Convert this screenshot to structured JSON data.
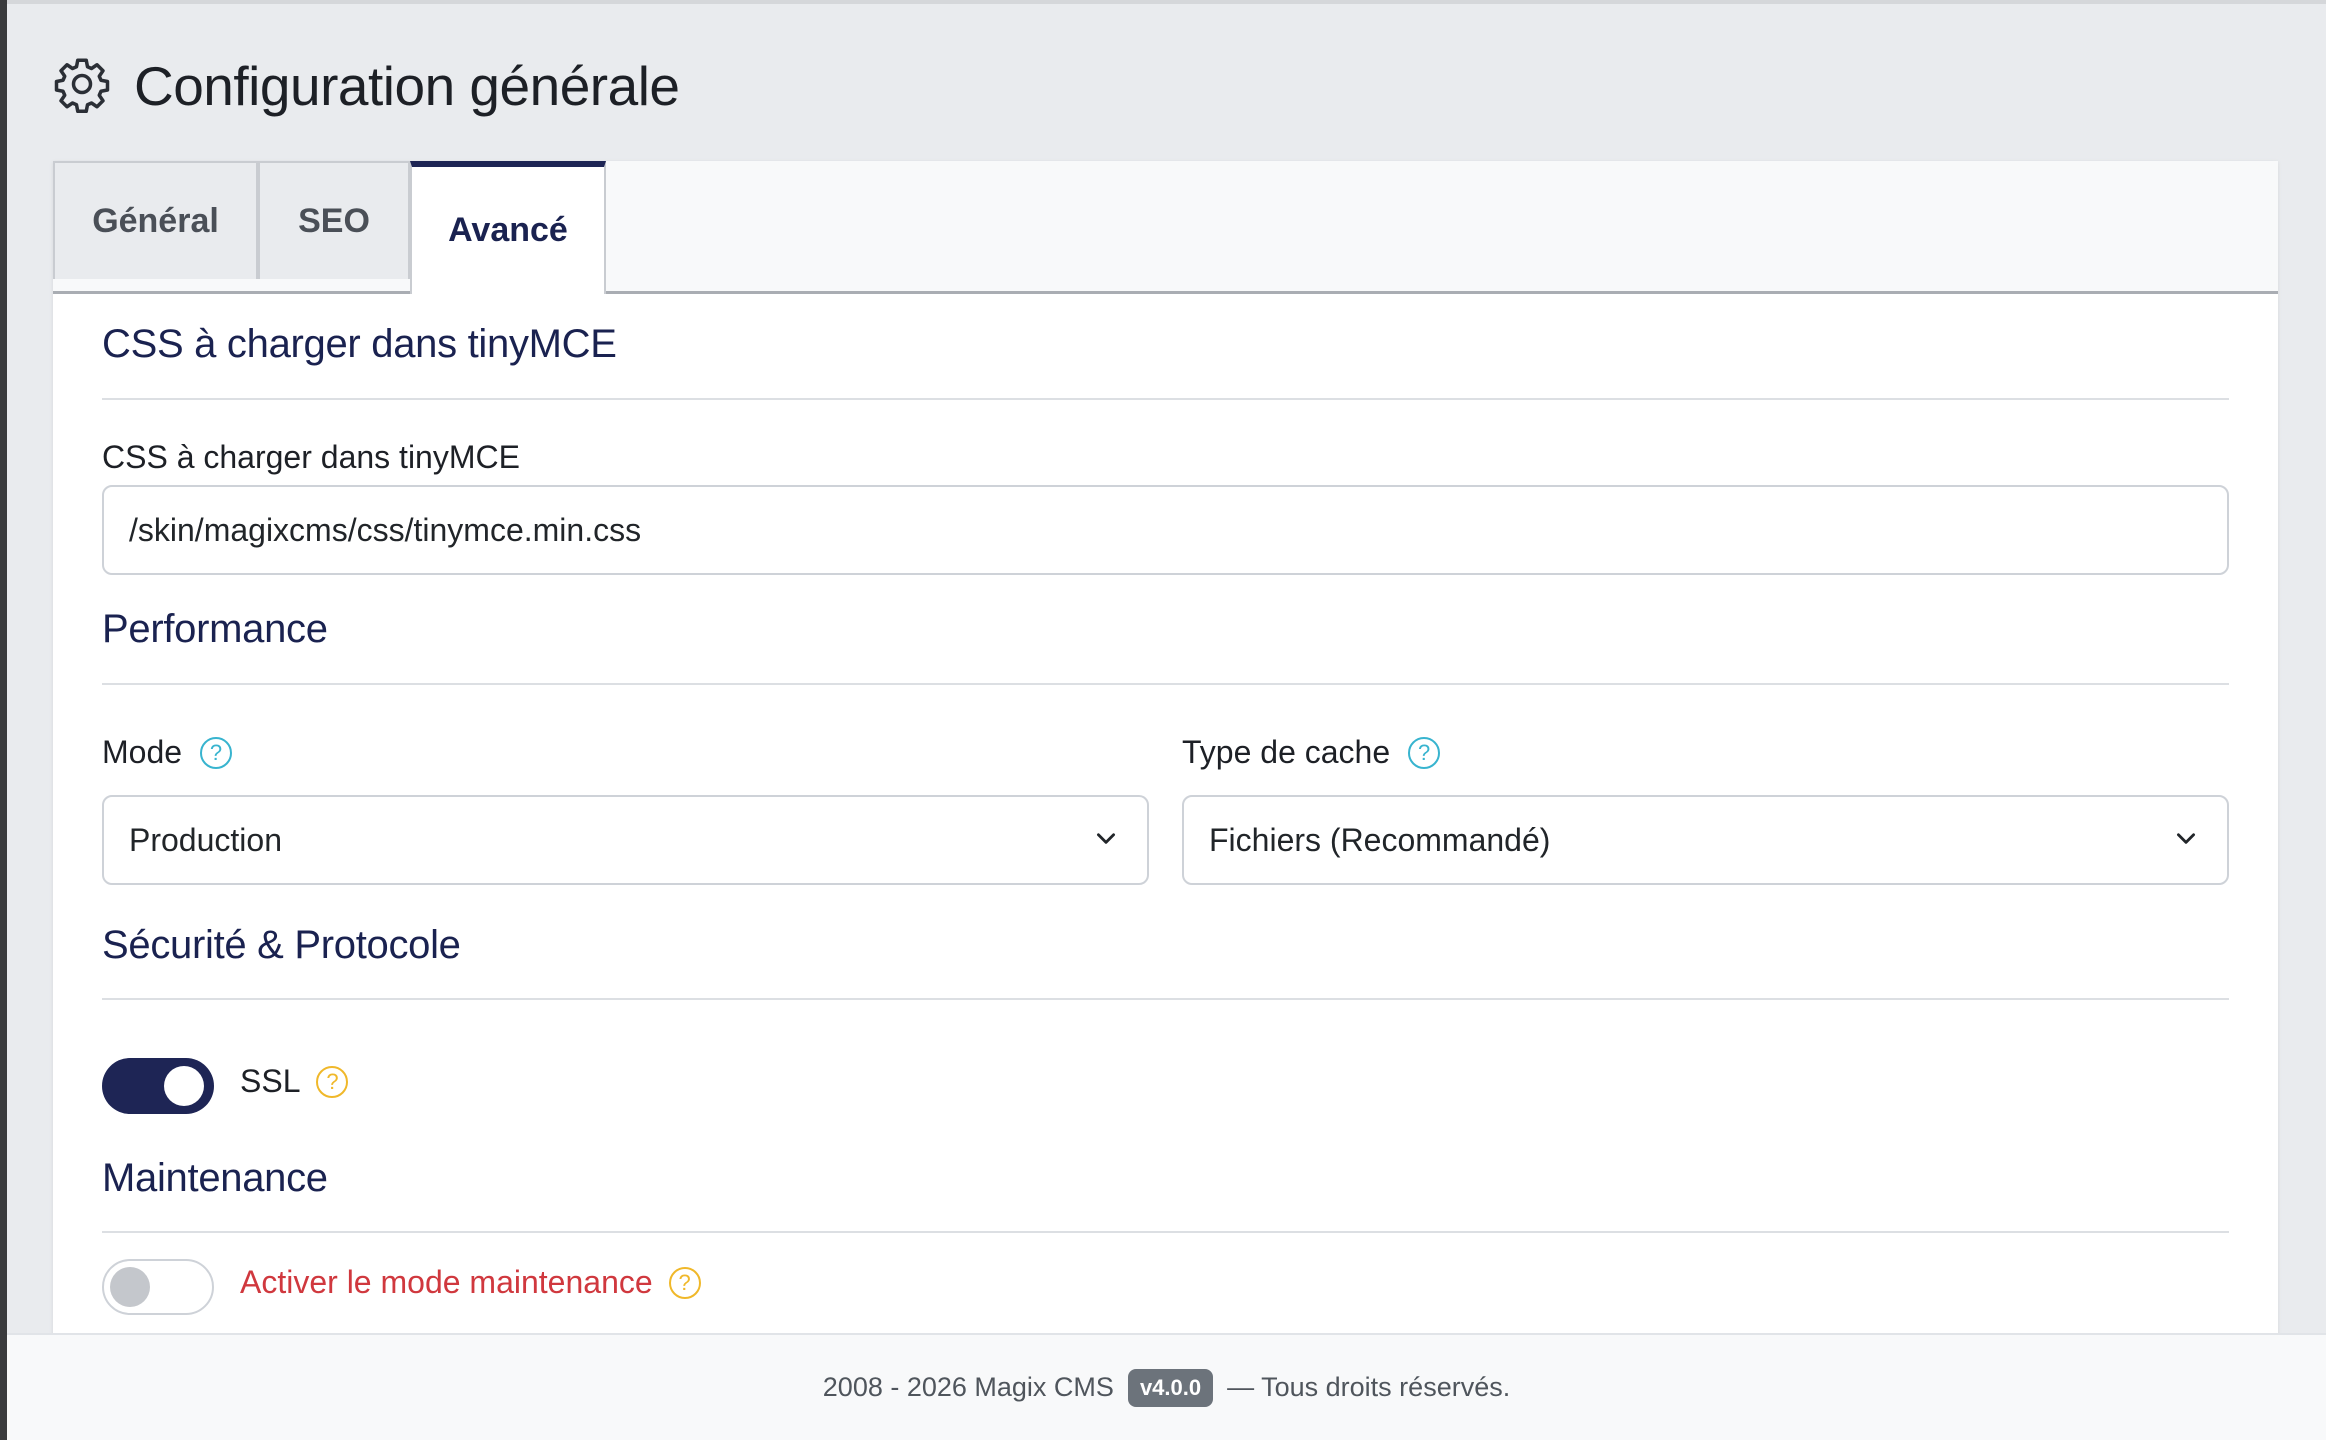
{
  "page": {
    "title": "Configuration générale",
    "icon": "gear-icon"
  },
  "tabs": [
    {
      "label": "Général",
      "active": false
    },
    {
      "label": "SEO",
      "active": false
    },
    {
      "label": "Avancé",
      "active": true
    }
  ],
  "tinymce": {
    "section_title": "CSS à charger dans tinyMCE",
    "field_label": "CSS à charger dans tinyMCE",
    "value": "/skin/magixcms/css/tinymce.min.css"
  },
  "performance": {
    "section_title": "Performance",
    "mode_label": "Mode",
    "mode_value": "Production",
    "cache_label": "Type de cache",
    "cache_value": "Fichiers (Recommandé)",
    "help_glyph": "?"
  },
  "security": {
    "section_title": "Sécurité & Protocole",
    "ssl_label": "SSL",
    "ssl_enabled": true
  },
  "maintenance": {
    "section_title": "Maintenance",
    "toggle_label": "Activer le mode maintenance",
    "enabled": false
  },
  "footer": {
    "text_left": "2008 - 2026 Magix CMS",
    "version": "v4.0.0",
    "text_right": "— Tous droits réservés."
  },
  "colors": {
    "accent": "#1e2555",
    "help_info": "#38b4cf",
    "help_warn": "#f0b82a",
    "danger_label": "#d0383e"
  }
}
